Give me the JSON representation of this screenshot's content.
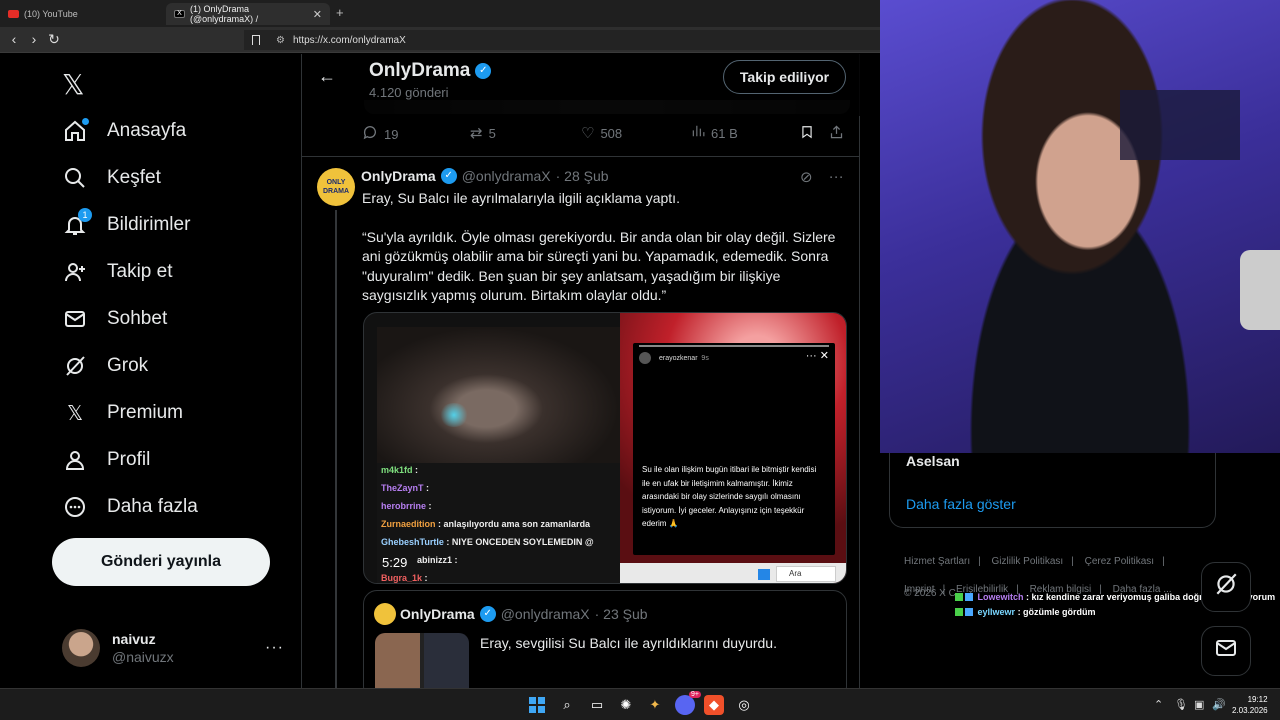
{
  "browser": {
    "tabs": [
      {
        "label": "(10) YouTube"
      },
      {
        "label": "(1) OnlyDrama (@onlydramaX) /"
      }
    ],
    "new_tab": "+",
    "url": "https://x.com/onlydramaX"
  },
  "sidebar": {
    "items": [
      {
        "label": "Anasayfa",
        "icon": "home-icon"
      },
      {
        "label": "Keşfet",
        "icon": "search-icon"
      },
      {
        "label": "Bildirimler",
        "icon": "bell-icon",
        "badge": "1"
      },
      {
        "label": "Takip et",
        "icon": "add-user-icon"
      },
      {
        "label": "Sohbet",
        "icon": "mail-icon"
      },
      {
        "label": "Grok",
        "icon": "grok-icon"
      },
      {
        "label": "Premium",
        "icon": "x-icon"
      },
      {
        "label": "Profil",
        "icon": "person-icon"
      },
      {
        "label": "Daha fazla",
        "icon": "more-icon"
      }
    ],
    "post_button": "Gönderi yayınla",
    "account": {
      "name": "naivuz",
      "handle": "@naivuzx",
      "more": "···"
    }
  },
  "profile_header": {
    "name": "OnlyDrama",
    "post_count": "4.120 gönderi",
    "follow_button": "Takip ediliyor"
  },
  "prev_tweet_actions": {
    "replies": "19",
    "retweets": "5",
    "likes": "508",
    "views": "61 B"
  },
  "tweet": {
    "name": "OnlyDrama",
    "handle": "@onlydramaX",
    "date": "· 28 Şub",
    "avatar_text": "ONLY DRAMA",
    "text1": "Eray, Su Balcı ile ayrılmalarıyla ilgili açıklama yaptı.",
    "text2": "“Su'yla ayrıldık. Öyle olması gerekiyordu. Bir anda olan bir olay değil. Sizlere ani gözükmüş olabilir ama bir süreçti yani bu. Yapamadık, edemedik. Sonra \"duyuralım\" dedik. Ben şuan bir şey anlatsam, yaşadığım bir ilişkiye saygısızlık yapmış olurum. Birtakım olaylar oldu.”",
    "media": {
      "timecode": "5:29",
      "chat": [
        {
          "user": "m4k1fd",
          "msg": ":"
        },
        {
          "user": "TheZaynT",
          "msg": ":"
        },
        {
          "user": "herobrrine",
          "msg": ":"
        },
        {
          "user": "Zurnaedition",
          "msg": ": anlaşılıyordu ama son zamanlarda"
        },
        {
          "user": "GhebeshTurtle",
          "msg": ": NIYE ONCEDEN SOYLEMEDIN @"
        },
        {
          "user": "abinizz1",
          "msg": ":"
        },
        {
          "user": "Bugra_1k",
          "msg": ":"
        }
      ],
      "story_user": "erayozkenar",
      "story_time": "9s",
      "story_text": "Su ile olan ilişkim bugün itibari ile bitmiştir kendisi ile en ufak bir iletişimim kalmamıştır. İkimiz arasındaki bir olay sizlerinde saygılı olmasını istiyorum. İyi geceler. Anlayışınız için teşekkür ederim 🙏",
      "search_text": "Ara"
    }
  },
  "quote": {
    "name": "OnlyDrama",
    "handle": "@onlydramaX",
    "date": "· 23 Şub",
    "text": "Eray, sevgilisi Su Balcı ile ayrıldıklarını duyurdu."
  },
  "right": {
    "trend": "Aselsan",
    "show_more": "Daha fazla göster",
    "footer": [
      "Hizmet Şartları",
      "Gizlilik Politikası",
      "Çerez Politikası",
      "Imprint",
      "Erişilebilirlik",
      "Reklam bilgisi",
      "Daha fazla ..."
    ],
    "copyright": "© 2026 X C"
  },
  "overlay_chat": [
    {
      "user": "Lowewitch",
      "msg": ": kız kendine zarar veriyomuş galiba doğru mu bilmiyorum"
    },
    {
      "user": "eyllwewr",
      "msg": ": gözümle gördüm"
    }
  ],
  "taskbar": {
    "time": "19:12",
    "date": "2.03.2026",
    "discord_badge": "9+"
  },
  "colors": {
    "accent": "#1d9bf0",
    "background": "#000000",
    "text": "#e7e9ea",
    "muted": "#71767b"
  }
}
